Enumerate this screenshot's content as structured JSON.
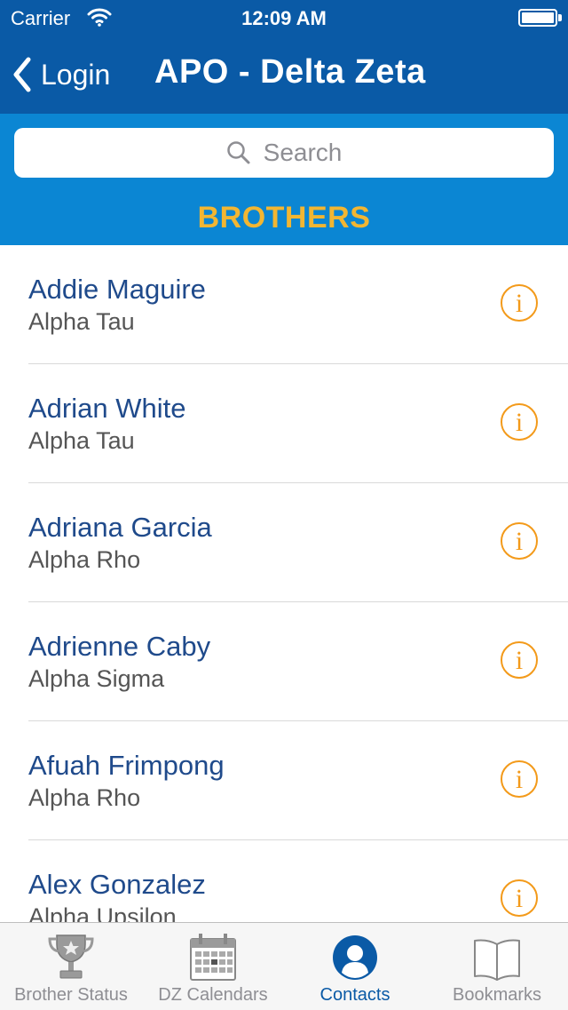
{
  "status_bar": {
    "carrier": "Carrier",
    "time": "12:09 AM",
    "battery_level": 1.0
  },
  "nav": {
    "back_label": "Login",
    "title": "APO - Delta Zeta"
  },
  "search": {
    "placeholder": "Search"
  },
  "section_title": "BROTHERS",
  "contacts": [
    {
      "name": "Addie Maguire",
      "chapter": "Alpha Tau"
    },
    {
      "name": "Adrian White",
      "chapter": "Alpha Tau"
    },
    {
      "name": "Adriana Garcia",
      "chapter": "Alpha Rho"
    },
    {
      "name": "Adrienne Caby",
      "chapter": "Alpha Sigma"
    },
    {
      "name": "Afuah Frimpong",
      "chapter": "Alpha Rho"
    },
    {
      "name": "Alex Gonzalez",
      "chapter": "Alpha Upsilon"
    }
  ],
  "info_glyph": "i",
  "tabs": [
    {
      "label": "Brother Status",
      "icon": "trophy-icon",
      "active": false
    },
    {
      "label": "DZ Calendars",
      "icon": "calendar-icon",
      "active": false
    },
    {
      "label": "Contacts",
      "icon": "contact-icon",
      "active": true
    },
    {
      "label": "Bookmarks",
      "icon": "book-icon",
      "active": false
    }
  ],
  "colors": {
    "nav_bg": "#0a5aa6",
    "search_bg": "#0b86d3",
    "section_gold": "#f2b632",
    "name_blue": "#1f4a8b",
    "info_orange": "#f39a1a"
  }
}
